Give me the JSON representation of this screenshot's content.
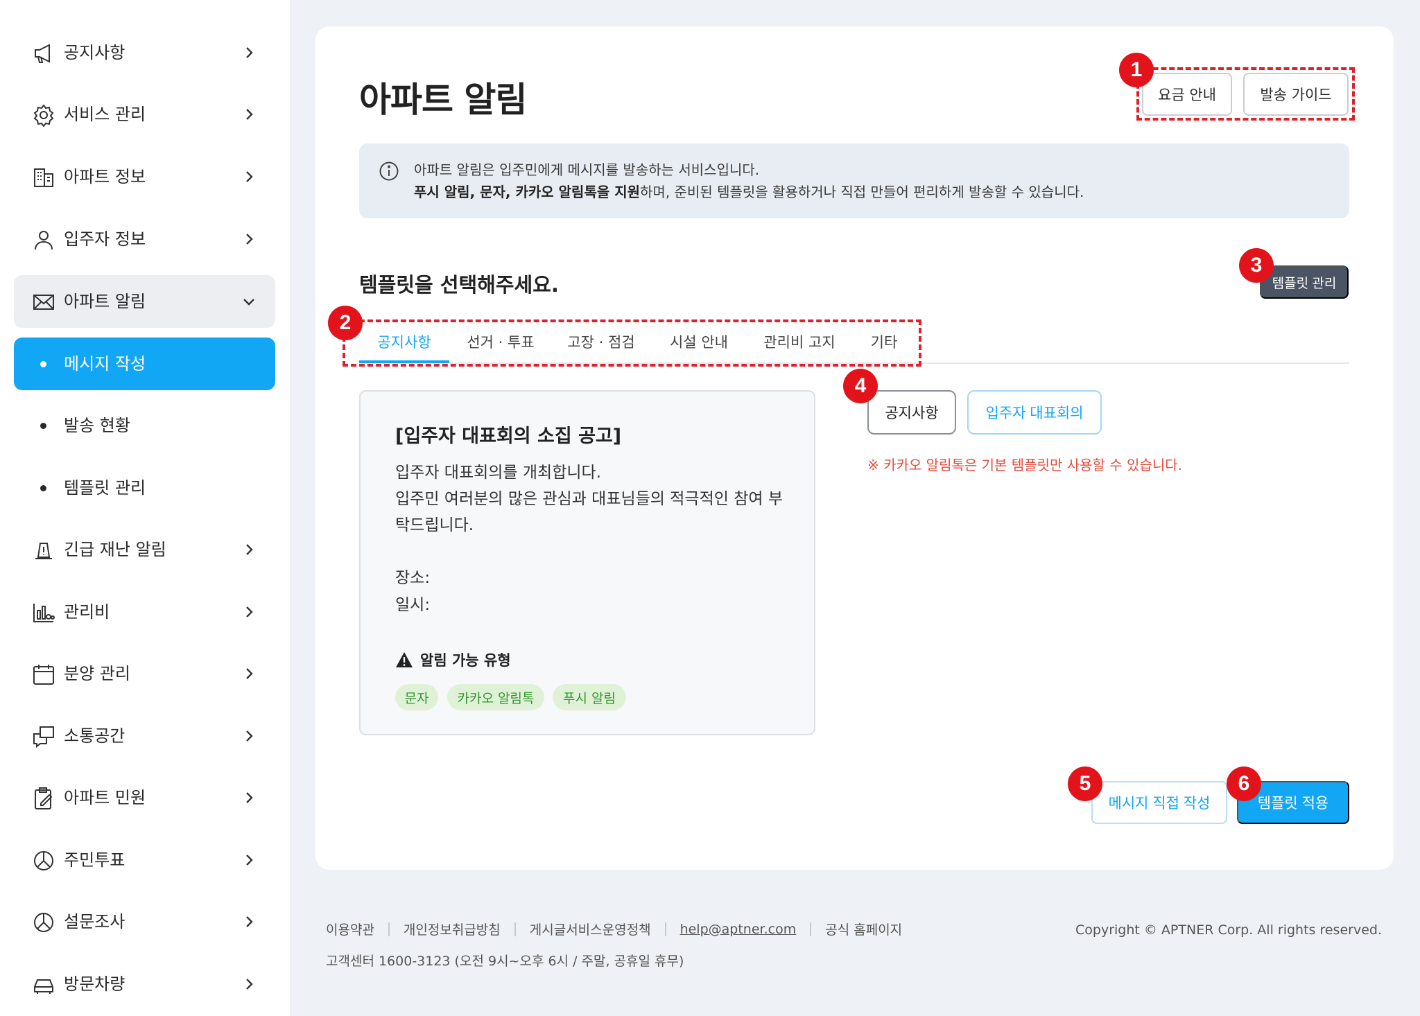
{
  "sidebar": {
    "items": [
      {
        "label": "공지사항",
        "icon": "megaphone-icon"
      },
      {
        "label": "서비스 관리",
        "icon": "gear-icon"
      },
      {
        "label": "아파트 정보",
        "icon": "building-icon"
      },
      {
        "label": "입주자 정보",
        "icon": "person-icon"
      },
      {
        "label": "아파트 알림",
        "icon": "envelope-icon"
      },
      {
        "label": "메시지 작성"
      },
      {
        "label": "발송 현황"
      },
      {
        "label": "템플릿 관리"
      },
      {
        "label": "긴급 재난 알림",
        "icon": "alert-icon"
      },
      {
        "label": "관리비",
        "icon": "bar-chart-icon"
      },
      {
        "label": "분양 관리",
        "icon": "calendar-icon"
      },
      {
        "label": "소통공간",
        "icon": "chat-icon"
      },
      {
        "label": "아파트 민원",
        "icon": "clipboard-icon"
      },
      {
        "label": "주민투표",
        "icon": "vote-icon"
      },
      {
        "label": "설문조사",
        "icon": "survey-icon"
      },
      {
        "label": "방문차량",
        "icon": "car-icon"
      }
    ]
  },
  "header": {
    "title": "아파트 알림",
    "pricing_label": "요금 안내",
    "guide_label": "발송 가이드"
  },
  "info": {
    "line1": "아파트 알림은 입주민에게 메시지를 발송하는 서비스입니다.",
    "line2_bold": "푸시 알림, 문자, 카카오 알림톡을 지원",
    "line2_rest": "하며, 준비된 템플릿을 활용하거나 직접 만들어 편리하게 발송할 수 있습니다."
  },
  "template_section": {
    "title": "템플릿을 선택해주세요.",
    "manage_label": "템플릿 관리"
  },
  "tabs": [
    {
      "label": "공지사항",
      "active": true
    },
    {
      "label": "선거 · 투표"
    },
    {
      "label": "고장 · 점검"
    },
    {
      "label": "시설 안내"
    },
    {
      "label": "관리비 고지"
    },
    {
      "label": "기타"
    }
  ],
  "template_card": {
    "title": "[입주자 대표회의 소집 공고]",
    "lines": [
      "입주자 대표회의를 개최합니다.",
      "입주민 여러분의 많은 관심과 대표님들의 적극적인 참여 부",
      "탁드립니다.",
      "장소:",
      "일시:"
    ],
    "types_label": "알림 가능 유형",
    "chips": [
      "문자",
      "카카오 알림톡",
      "푸시 알림"
    ]
  },
  "categories": [
    "공지사항",
    "입주자 대표회의"
  ],
  "note": "※ 카카오 알림톡은 기본 템플릿만 사용할 수 있습니다.",
  "actions": {
    "write_label": "메시지 직접 작성",
    "apply_label": "템플릿 적용"
  },
  "badges": [
    "1",
    "2",
    "3",
    "4",
    "5",
    "6"
  ],
  "footer": {
    "links": [
      "이용약관",
      "개인정보취급방침",
      "게시글서비스운영정책",
      "help@aptner.com",
      "공식 홈페이지"
    ],
    "cs": "고객센터 1600-3123 (오전 9시~오후 6시 / 주말, 공휴일 휴무)",
    "copyright": "Copyright © APTNER Corp. All rights reserved."
  },
  "colors": {
    "accent": "#12a7f5",
    "annotation_red": "#e3131b",
    "chip_green": "#37942f"
  }
}
